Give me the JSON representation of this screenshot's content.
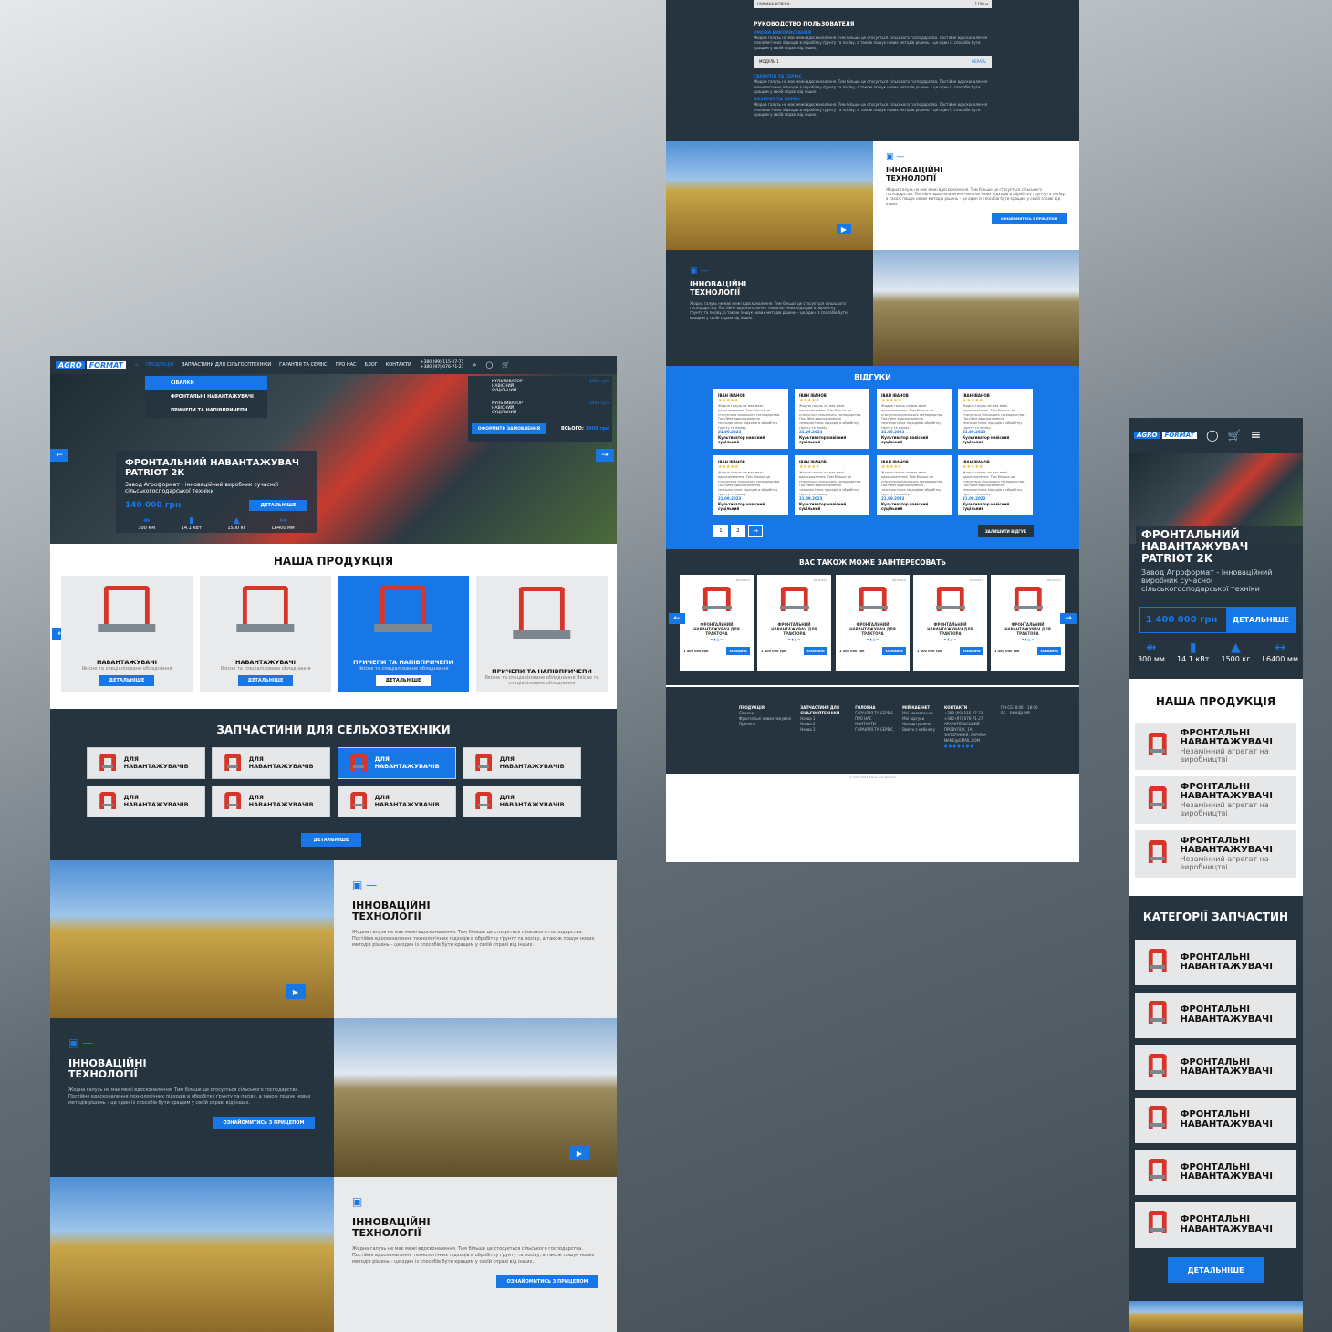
{
  "brand": {
    "logo_left": "AGRO",
    "logo_right": "FORMAT"
  },
  "desktop": {
    "nav": [
      "ПРОДУКЦІЯ",
      "ЗАПЧАСТИНИ ДЛЯ СІЛЬГОСПТЕХНІКИ",
      "ГАРАНТІЯ ТА СЕРВІС",
      "ПРО НАС",
      "БЛОГ",
      "КОНТАКТИ"
    ],
    "phones": [
      "+380 (99) 115-27-71",
      "+380 (97) 076-71-27"
    ],
    "dropdown": [
      "СІВАЛКИ",
      "ФРОНТАЛЬНІ НАВАНТАЖУВАЧІ",
      "ПРИЧЕПИ ТА НАПІВПРИЧЕПИ"
    ],
    "cart": {
      "items": [
        {
          "name": "КУЛЬТИВАТОР НАВІСНИЙ СУЦІЛЬНИЙ",
          "status": "Актуальні",
          "price": "1400 грн",
          "qty": "1"
        },
        {
          "name": "КУЛЬТИВАТОР НАВІСНИЙ СУЦІЛЬНИЙ",
          "status": "Актуальні",
          "price": "1400 грн",
          "qty": "1"
        }
      ],
      "checkout": "ОФОРМИТИ ЗАМОВЛЕННЯ",
      "total_label": "ВСЬОГО:",
      "total": "1400 грн"
    },
    "hero": {
      "title": "ФРОНТАЛЬНИЙ НАВАНТАЖУВАЧ PATRIOT 2K",
      "subtitle": "Завод Агроформат - інноваційний виробник сучасної сільськогосподарської техніки",
      "price": "140 000 грн",
      "button": "ДЕТАЛЬНІШЕ",
      "specs": [
        "300 мм",
        "14.1 кВт",
        "1500 кг",
        "L6400 мм"
      ]
    },
    "products": {
      "title": "НАША ПРОДУКЦІЯ",
      "items": [
        {
          "name": "НАВАНТАЖУВАЧІ",
          "desc": "Якісне та спеціалізоване обладнання"
        },
        {
          "name": "НАВАНТАЖУВАЧІ",
          "desc": "Якісне та спеціалізоване обладнання"
        },
        {
          "name": "ПРИЧЕПИ ТА НАПІВПРИЧЕПИ",
          "desc": "Якісне та спеціалізоване обладнання"
        },
        {
          "name": "ПРИЧЕПИ ТА НАПІВПРИЧЕПИ",
          "desc": "Якісне та спеціалізоване обладнання Якісне та спеціалізоване обладнання"
        }
      ],
      "button": "ДЕТАЛЬНІШЕ"
    },
    "parts": {
      "title": "ЗАПЧАСТИНИ ДЛЯ СЕЛЬХОЗТЕХНІКИ",
      "item": "ДЛЯ НАВАНТАЖУВАЧІВ",
      "button": "ДЕТАЛЬНІШЕ"
    },
    "innov": {
      "title": "ІННОВАЦІЙНІ ТЕХНОЛОГІЇ",
      "text": "Жодна галузь не має межі вдосконалення. Тим більше це стосується сільського господарства. Постійне вдосконалення технологічних підходів в обробітку ґрунту та посіву, а також пошук нових методів рішень – це один із способів бути кращим у своїй справі від інших.",
      "button": "ОЗНАЙОМИТИСЬ З ПРИЦЕПОМ"
    }
  },
  "tablet": {
    "guide_title": "РУКОВОДСТВО ПОЛЬЗОВАТЕЛЯ",
    "guide_sections": [
      "УМОВИ ВИКОРИСТАННЯ",
      "ГАРАНТІЯ ТА СЕРВІС",
      "ВОЗВРАТ ТА ОБМІН"
    ],
    "module": {
      "name": "МОДУЛЬ 1",
      "action": "ОБРАТЬ"
    },
    "top_row": {
      "label": "ШИРИНА КОВША:",
      "value": "1100 м"
    },
    "reviews": {
      "title": "ВІДГУКИ",
      "name": "ІВАН ІВАНОВ",
      "stars": "★★★★★",
      "text": "Жодна галузь не має межі вдосконалення. Тим більше це стосується сільського господарства. Постійне вдосконалення технологічних підходів в обробітку ґрунту та посіву.",
      "date": "21.09.2023",
      "product": "Культиватор навісний суцільний",
      "pages": [
        "1",
        "2"
      ],
      "button": "ЗАЛИШИТИ ВІДГУК"
    },
    "interest": {
      "title": "ВАС ТАКОЖ МОЖЕ ЗАІНТЕРЕСОВАТЬ",
      "label": "Артикул",
      "name": "ФРОНТАЛЬНИЙ НАВАНТАЖУВАЧ ДЛЯ ТРАКТОРА",
      "price": "1 400 000 грн",
      "button": "ЗАМОВИТИ"
    },
    "footer": {
      "cols": [
        {
          "h": "ПРОДУКЦІЯ",
          "items": [
            "Сівалки",
            "Фронтальні навантажувачі",
            "Причепи"
          ]
        },
        {
          "h": "ЗАПЧАСТИНИ ДЛЯ СІЛЬГОСПТЕХНІКИ",
          "items": [
            "Назва 1",
            "Назва 2",
            "Назва 3"
          ]
        },
        {
          "h": "ГОЛОВНА",
          "items": [
            "ГАРАНТІЯ ТА СЕРВІС",
            "ПРО НАС",
            "КОНТАКТИ",
            "ГАРАНТІЯ ТА СЕРВІС"
          ]
        },
        {
          "h": "МІЙ КАБІНЕТ",
          "items": [
            "Мої замовлення",
            "Мої відгуки",
            "Налаштування",
            "Вийти з кабінету"
          ]
        },
        {
          "h": "КОНТАКТИ",
          "items": [
            "+380 (99) 115-27-71",
            "+380 (97) 076-71-27",
            "АРХАНГЕЛЬСЬКИЙ ПРОВУЛОК, 1А, ЗАПОРІЖЖЯ, УКРАЇНА",
            "NAME@GMAIL.COM"
          ]
        }
      ],
      "hours": [
        "ПН-СБ: 8:00 – 18:00",
        "ВС – ВИХІДНИЙ"
      ],
      "copyright": "© 1999-2023 Завод Агроформат"
    }
  },
  "mobile": {
    "hero": {
      "title": "ФРОНТАЛЬНИЙ НАВАНТАЖУВАЧ PATRIOT 2K",
      "subtitle": "Завод Агроформат - інноваційний виробник сучасної сільськогосподарської техніки",
      "price": "1 400 000 грн",
      "button": "ДЕТАЛЬНІШЕ",
      "specs": [
        "300 мм",
        "14.1 кВт",
        "1500 кг",
        "L6400 мм"
      ]
    },
    "products": {
      "title": "НАША ПРОДУКЦІЯ",
      "items": [
        {
          "name": "ФРОНТАЛЬНІ НАВАНТАЖУВАЧІ",
          "desc": "Незамінний агрегат на виробництві"
        },
        {
          "name": "ФРОНТАЛЬНІ НАВАНТАЖУВАЧІ",
          "desc": "Незамінний агрегат на виробництві"
        },
        {
          "name": "ФРОНТАЛЬНІ НАВАНТАЖУВАЧІ",
          "desc": "Незамінний агрегат на виробництві"
        }
      ]
    },
    "categories": {
      "title": "КАТЕГОРІЇ ЗАПЧАСТИН",
      "item": "ФРОНТАЛЬНІ НАВАНТАЖУВАЧІ",
      "button": "ДЕТАЛЬНІШЕ"
    }
  }
}
